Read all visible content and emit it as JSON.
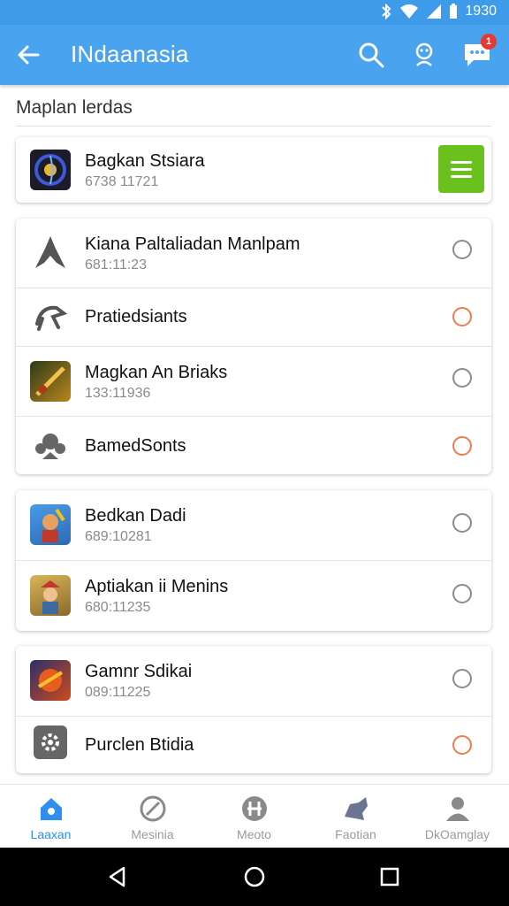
{
  "status": {
    "time": "1930"
  },
  "appbar": {
    "title": "INdaanasia",
    "notification_count": "1"
  },
  "section": {
    "title": "Maplan lerdas"
  },
  "featured": {
    "name": "Bagkan Stsiara",
    "sub": "6738 11721"
  },
  "group1": [
    {
      "name": "Kiana Paltaliadan Manlpam",
      "sub": "681:11:23",
      "selected": false
    },
    {
      "name": "Pratiedsiants",
      "sub": "",
      "selected": true
    },
    {
      "name": "Magkan An Briaks",
      "sub": "133:11936",
      "selected": false
    },
    {
      "name": "BamedSonts",
      "sub": "",
      "selected": true
    }
  ],
  "group2": [
    {
      "name": "Bedkan Dadi",
      "sub": "689:10281",
      "selected": false
    },
    {
      "name": "Aptiakan ii Menins",
      "sub": "680:11235",
      "selected": false
    }
  ],
  "group3": [
    {
      "name": "Gamnr Sdikai",
      "sub": "089:11225",
      "selected": false
    },
    {
      "name": "Purclen Btidia",
      "sub": "",
      "selected": true
    }
  ],
  "tabs": [
    {
      "label": "Laaxan",
      "active": true
    },
    {
      "label": "Mesinia",
      "active": false
    },
    {
      "label": "Meoto",
      "active": false
    },
    {
      "label": "Faotian",
      "active": false
    },
    {
      "label": "DkOamglay",
      "active": false
    }
  ],
  "colors": {
    "primary": "#4aa3ee",
    "accent_green": "#6ac11d",
    "radio_on": "#ef7d4b",
    "badge": "#e53935"
  }
}
